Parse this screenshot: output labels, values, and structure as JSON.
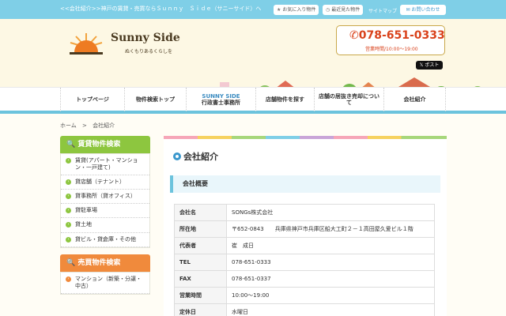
{
  "topbar": {
    "tagline": "<<会社紹介>>神戸の賃貸・売買ならＳｕｎｎｙ　Ｓｉｄｅ（サニーサイド）へ",
    "favorites": "お気に入り物件",
    "recent": "最近見た物件",
    "sitemap": "サイトマップ",
    "contact": "お問い合わせ"
  },
  "header": {
    "logo": "Sunny Side",
    "logo_sub": "ぬくもりあるくらしを",
    "phone": "078-651-0333",
    "hours": "営業時間/10:00～19:00",
    "post": "ポスト"
  },
  "nav": [
    {
      "label": "トップページ"
    },
    {
      "label": "物件検索トップ"
    },
    {
      "label": "SUNNY SIDE",
      "label2": "行政書士事務所"
    },
    {
      "label": "店舗物件を探す"
    },
    {
      "label": "店舗の居抜き売却について"
    },
    {
      "label": "会社紹介"
    }
  ],
  "breadcrumb": {
    "home": "ホーム",
    "sep": ">",
    "current": "会社紹介"
  },
  "sidebar": {
    "rent_title": "賃貸物件検索",
    "rent_items": [
      "賃貸(アパート・マンション・一戸建て)",
      "貸店舗（テナント）",
      "貸事務所（貸オフィス）",
      "貸駐車場",
      "貸土地",
      "貸ビル・貸倉庫・その他"
    ],
    "sale_title": "売買物件検索",
    "sale_items": [
      "マンション（新築・分譲・中古）"
    ]
  },
  "main": {
    "title": "会社紹介",
    "section": "会社概要",
    "rows": [
      {
        "k": "会社名",
        "v": "SONGs株式会社"
      },
      {
        "k": "所在地",
        "v": "〒652-0843　　兵庫県神戸市兵庫区船大工町２－１高田屋久爱ビル１階"
      },
      {
        "k": "代表者",
        "v": "崔　成日"
      },
      {
        "k": "TEL",
        "v": "078-651-0333"
      },
      {
        "k": "FAX",
        "v": "078-651-0337"
      },
      {
        "k": "営業時間",
        "v": "10:00〜19:00"
      },
      {
        "k": "定休日",
        "v": "水曜日"
      }
    ]
  }
}
